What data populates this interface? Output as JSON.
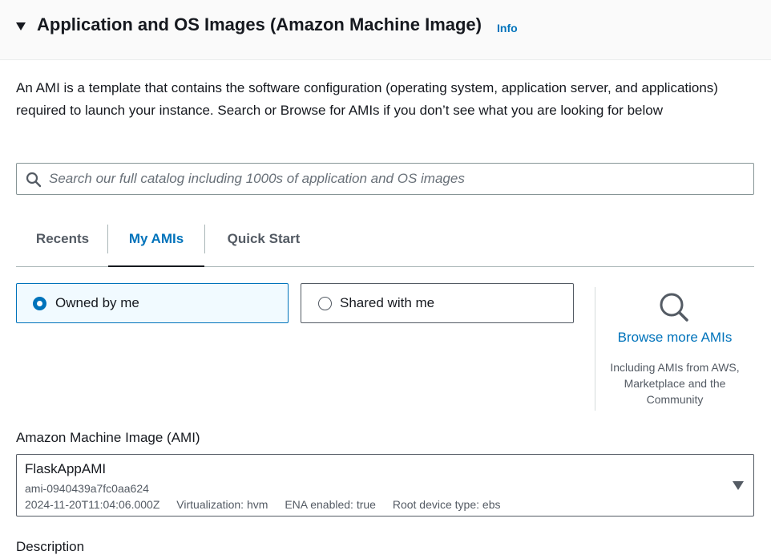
{
  "section": {
    "title": "Application and OS Images (Amazon Machine Image)",
    "info_label": "Info",
    "description": "An AMI is a template that contains the software configuration (operating system, application server, and applications) required to launch your instance. Search or Browse for AMIs if you don’t see what you are looking for below"
  },
  "search": {
    "placeholder": "Search our full catalog including 1000s of application and OS images",
    "value": ""
  },
  "tabs": [
    {
      "label": "Recents",
      "active": false
    },
    {
      "label": "My AMIs",
      "active": true
    },
    {
      "label": "Quick Start",
      "active": false
    }
  ],
  "ownership": {
    "options": [
      {
        "label": "Owned by me",
        "selected": true
      },
      {
        "label": "Shared with me",
        "selected": false
      }
    ]
  },
  "browse": {
    "link_label": "Browse more AMIs",
    "subtext": "Including AMIs from AWS, Marketplace and the Community"
  },
  "ami": {
    "field_label": "Amazon Machine Image (AMI)",
    "name": "FlaskAppAMI",
    "id": "ami-0940439a7fc0aa624",
    "created": "2024-11-20T11:04:06.000Z",
    "virtualization": "Virtualization: hvm",
    "ena": "ENA enabled: true",
    "root_device": "Root device type: ebs"
  },
  "next_field_label": "Description",
  "colors": {
    "accent": "#0073bb",
    "text": "#16191f",
    "secondary_text": "#545b64",
    "selected_bg": "#f1faff",
    "header_bg": "#fafafa"
  },
  "icons": [
    "caret-down-icon",
    "search-icon",
    "magnifier-icon",
    "dropdown-caret-icon"
  ]
}
